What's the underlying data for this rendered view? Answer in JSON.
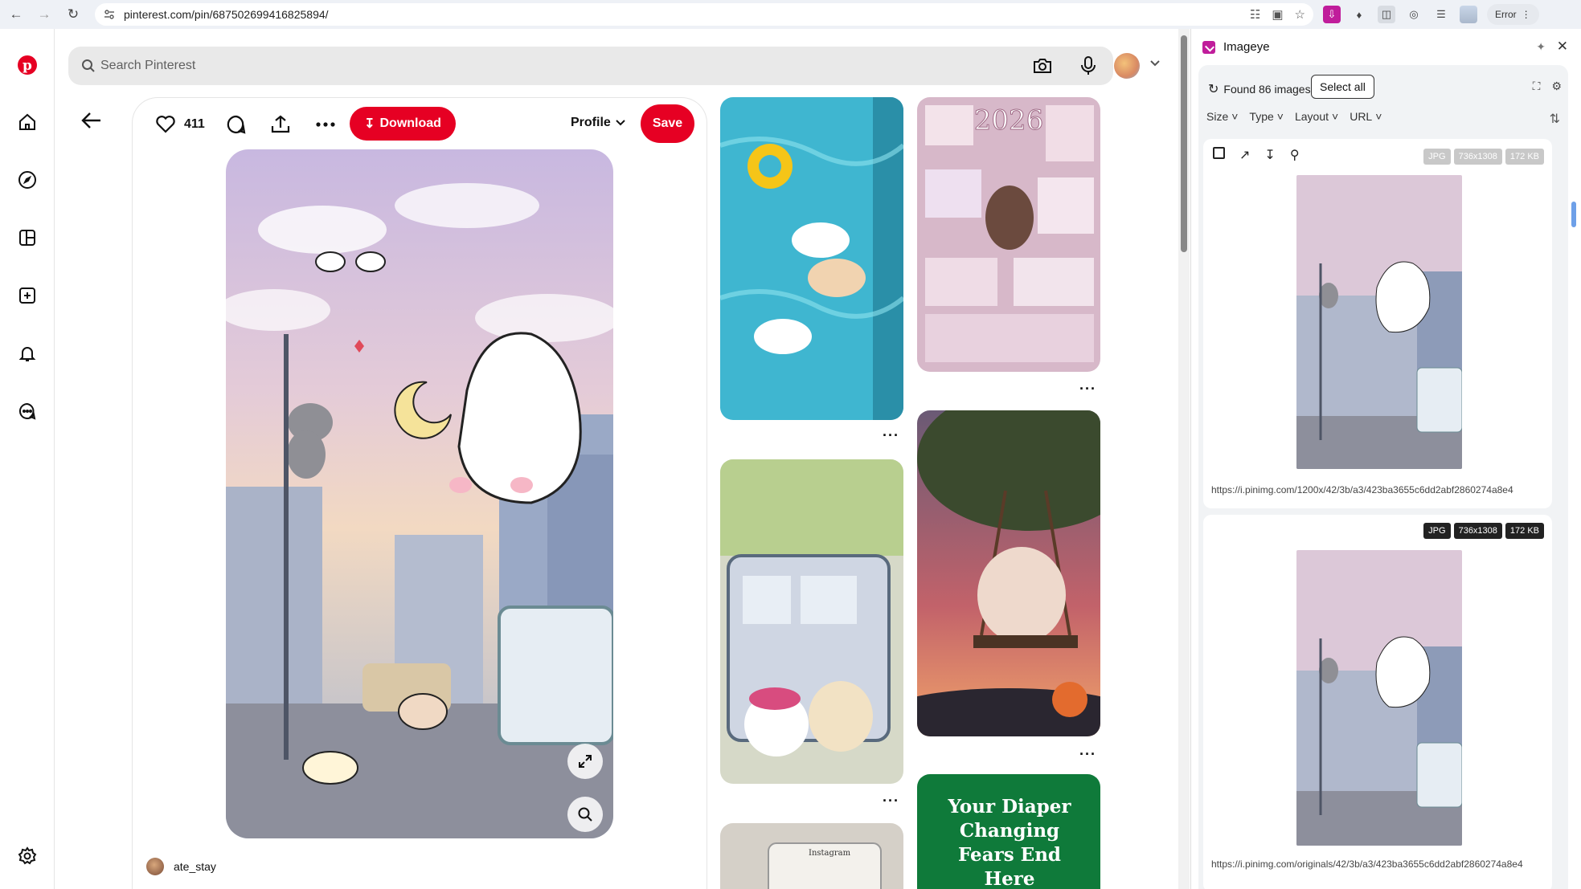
{
  "browser": {
    "url": "pinterest.com/pin/687502699416825894/",
    "error_label": "Error"
  },
  "search": {
    "placeholder": "Search Pinterest"
  },
  "pin": {
    "like_count": "411",
    "download_label": "Download",
    "profile_label": "Profile",
    "save_label": "Save",
    "creator": "ate_stay"
  },
  "grid": {
    "ad_text": "Your Diaper Changing Fears End Here",
    "phone_text": "Instagram"
  },
  "imageye": {
    "title": "Imageye",
    "found": "Found 86 images",
    "select_all": "Select all",
    "filters": [
      "Size",
      "Type",
      "Layout",
      "URL"
    ],
    "images": [
      {
        "format": "JPG",
        "dims": "736x1308",
        "size": "172 KB",
        "url": "https://i.pinimg.com/1200x/42/3b/a3/423ba3655c6dd2abf2860274a8e4"
      },
      {
        "format": "JPG",
        "dims": "736x1308",
        "size": "172 KB",
        "url": "https://i.pinimg.com/originals/42/3b/a3/423ba3655c6dd2abf2860274a8e4"
      }
    ]
  },
  "colors": {
    "brand": "#e60023",
    "imageye": "#c01d9b"
  }
}
